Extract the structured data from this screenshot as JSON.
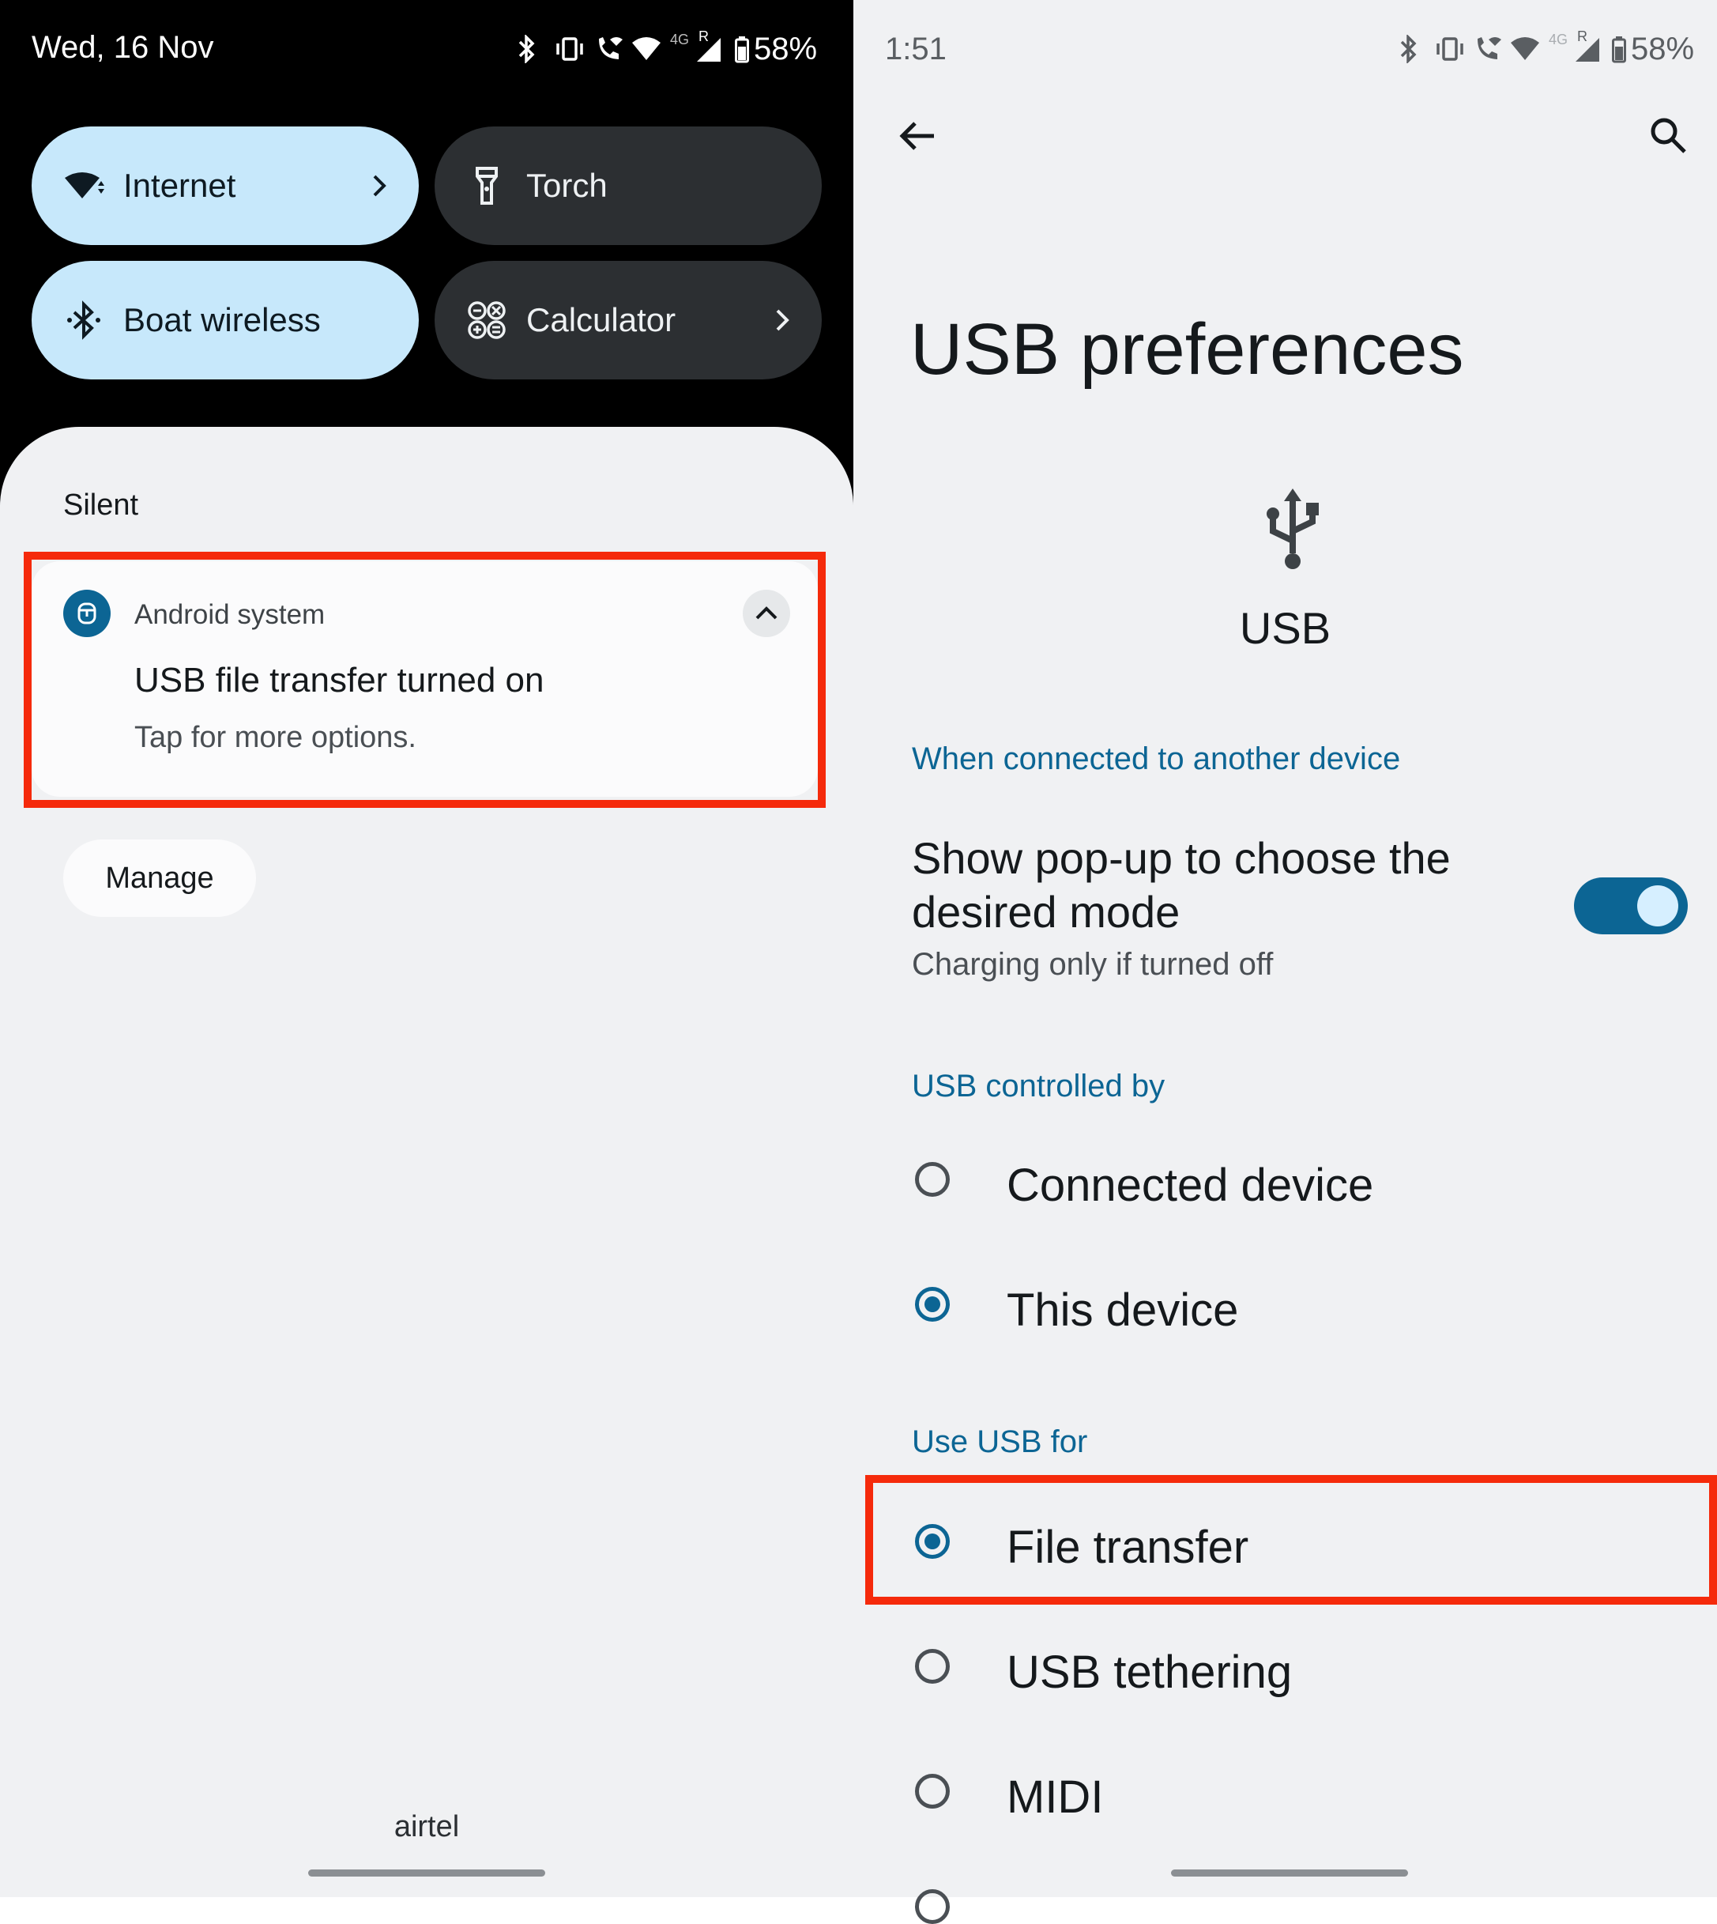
{
  "left": {
    "status": {
      "date": "Wed, 16 Nov",
      "network": "4G",
      "roaming": "R",
      "battery": "58%"
    },
    "tiles": [
      {
        "label": "Internet",
        "icon": "wifi-icon",
        "state": "on",
        "chevron": true
      },
      {
        "label": "Torch",
        "icon": "flashlight-icon",
        "state": "off",
        "chevron": false
      },
      {
        "label": "Boat wireless",
        "icon": "bluetooth-icon",
        "state": "on",
        "chevron": false
      },
      {
        "label": "Calculator",
        "icon": "calculator-icon",
        "state": "off",
        "chevron": true
      }
    ],
    "section_label": "Silent",
    "notification": {
      "app": "Android system",
      "title": "USB file transfer turned on",
      "body": "Tap for more options."
    },
    "manage_label": "Manage",
    "carrier": "airtel"
  },
  "right": {
    "status": {
      "time": "1:51",
      "network": "4G",
      "roaming": "R",
      "battery": "58%"
    },
    "page_title": "USB preferences",
    "hero_label": "USB",
    "section_connected": "When connected to another device",
    "popup_setting": {
      "title": "Show pop-up to choose the desired mode",
      "subtitle": "Charging only if turned off",
      "enabled": true
    },
    "section_controlled": "USB controlled by",
    "controlled_options": [
      {
        "label": "Connected device",
        "selected": false
      },
      {
        "label": "This device",
        "selected": true
      }
    ],
    "section_use": "Use USB for",
    "use_options": [
      {
        "label": "File transfer",
        "selected": true
      },
      {
        "label": "USB tethering",
        "selected": false
      },
      {
        "label": "MIDI",
        "selected": false
      }
    ]
  },
  "colors": {
    "accent": "#0c6594",
    "highlight": "#f52a0b",
    "tile_on": "#c7e8fb",
    "tile_off": "#2c2f32"
  }
}
